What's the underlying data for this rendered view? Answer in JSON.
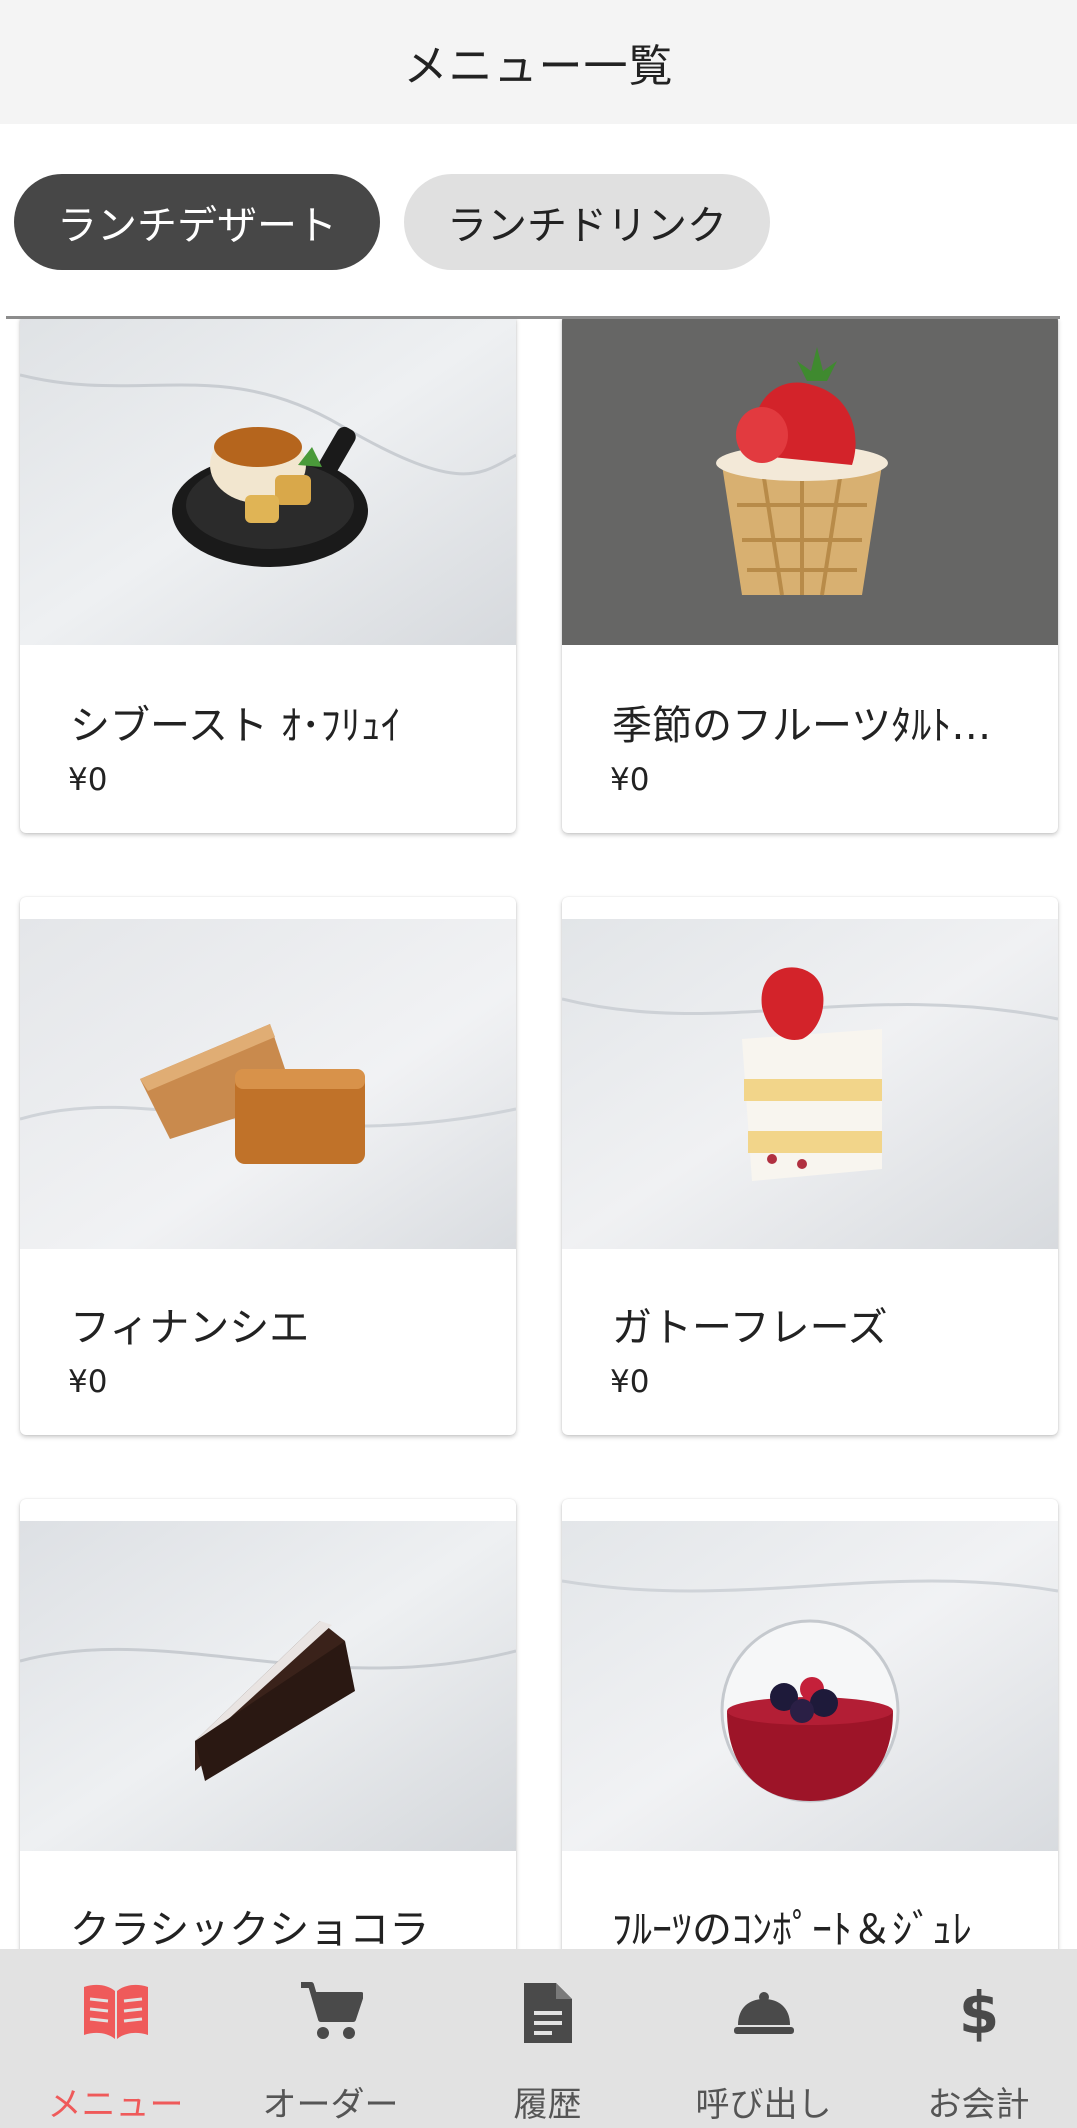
{
  "header": {
    "title": "メニュー一覧"
  },
  "tabs": [
    {
      "label": "ランチデザート"
    },
    {
      "label": "ランチドリンク"
    }
  ],
  "menu_items": [
    {
      "name": "シブースト ｵ･ﾌﾘｭｲ",
      "price": "¥0",
      "image": "creme-brulee-with-apple-image"
    },
    {
      "name": "季節のフルーツﾀﾙﾄ…",
      "price": "¥0",
      "image": "strawberry-tart-image"
    },
    {
      "name": "フィナンシエ",
      "price": "¥0",
      "image": "financier-image"
    },
    {
      "name": "ガトーフレーズ",
      "price": "¥0",
      "image": "strawberry-shortcake-image"
    },
    {
      "name": "クラシックショコラ",
      "price": "",
      "image": "chocolate-cake-image"
    },
    {
      "name": "ﾌﾙｰﾂのｺﾝﾎﾟｰﾄ＆ｼﾞｭﾚ",
      "price": "",
      "image": "fruit-compote-jelly-image"
    }
  ],
  "bottom_nav": [
    {
      "label": "メニュー",
      "icon": "menu-book-icon",
      "active": true
    },
    {
      "label": "オーダー",
      "icon": "cart-icon",
      "active": false
    },
    {
      "label": "履歴",
      "icon": "history-document-icon",
      "active": false
    },
    {
      "label": "呼び出し",
      "icon": "service-bell-icon",
      "active": false
    },
    {
      "label": "お会計",
      "icon": "dollar-icon",
      "active": false
    }
  ],
  "colors": {
    "accent": "#ef5a5a",
    "tab_active_bg": "#474747",
    "tab_inactive_bg": "#e0e0e0",
    "header_bg": "#f4f4f4",
    "nav_bg": "#e2e2e2"
  }
}
